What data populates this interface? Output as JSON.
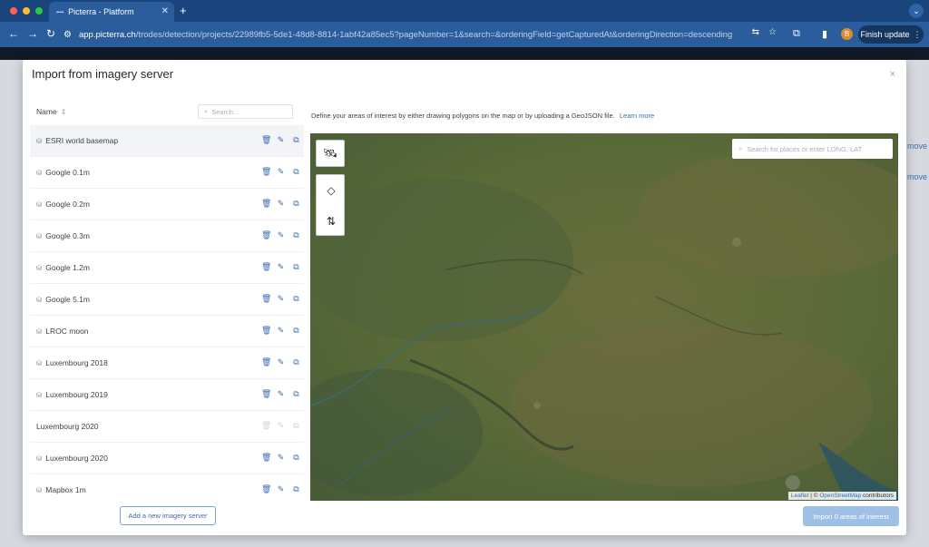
{
  "browser": {
    "tab_title": "Picterra - Platform",
    "address_host": "app.picterra.ch",
    "address_path": "/trodes/detection/projects/22989fb5-5de1-48d8-8814-1abf42a85ec5?pageNumber=1&search=&orderingField=getCapturedAt&orderingDirection=descending",
    "finish_update_label": "Finish update",
    "profile_initial": "B"
  },
  "background": {
    "more_labels": [
      "move",
      "move"
    ]
  },
  "modal": {
    "title": "Import from imagery server",
    "close_glyph": "×"
  },
  "list": {
    "name_header": "Name",
    "search_placeholder": "Search...",
    "items": [
      {
        "label": "ESRI world basemap",
        "has_icon": true,
        "enabled": true
      },
      {
        "label": "Google 0.1m",
        "has_icon": true,
        "enabled": true
      },
      {
        "label": "Google 0.2m",
        "has_icon": true,
        "enabled": true
      },
      {
        "label": "Google 0.3m",
        "has_icon": true,
        "enabled": true
      },
      {
        "label": "Google 1.2m",
        "has_icon": true,
        "enabled": true
      },
      {
        "label": "Google 5.1m",
        "has_icon": true,
        "enabled": true
      },
      {
        "label": "LROC moon",
        "has_icon": true,
        "enabled": true
      },
      {
        "label": "Luxembourg 2018",
        "has_icon": true,
        "enabled": true
      },
      {
        "label": "Luxembourg 2019",
        "has_icon": true,
        "enabled": true
      },
      {
        "label": "Luxembourg 2020",
        "has_icon": false,
        "enabled": false
      },
      {
        "label": "Luxembourg 2020",
        "has_icon": true,
        "enabled": true
      },
      {
        "label": "Mapbox 1m",
        "has_icon": true,
        "enabled": true
      }
    ],
    "add_button_label": "Add a new imagery server"
  },
  "map": {
    "description": "Define your areas of interest by either drawing polygons on the map or by uploading a GeoJSON file.",
    "learn_more_label": "Learn more",
    "search_placeholder": "Search for places or enter LONG, LAT",
    "attribution_leaflet": "Leaflet",
    "attribution_sep": "| ©",
    "attribution_osm": "OpenStreetMap",
    "attribution_contrib": "contributors",
    "import_button_label": "Import 0 areas of interest"
  },
  "colors": {
    "accent": "#3b6db3",
    "chrome": "#2b5c9c",
    "import_disabled": "#9ebfe6"
  }
}
